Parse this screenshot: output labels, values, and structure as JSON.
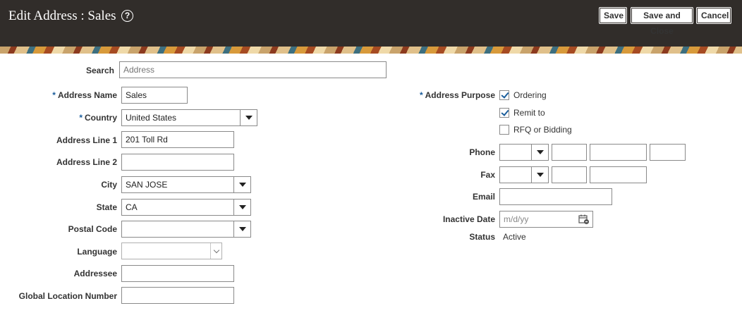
{
  "header": {
    "title": "Edit Address : Sales",
    "save_label": "Save",
    "save_close_label": "Save and Close",
    "cancel_label": "Cancel"
  },
  "search": {
    "label": "Search",
    "placeholder": "Address"
  },
  "left": {
    "address_name": {
      "label": "Address Name",
      "value": "Sales"
    },
    "country": {
      "label": "Country",
      "value": "United States"
    },
    "address_line1": {
      "label": "Address Line 1",
      "value": "201 Toll Rd"
    },
    "address_line2": {
      "label": "Address Line 2",
      "value": ""
    },
    "city": {
      "label": "City",
      "value": "SAN JOSE"
    },
    "state": {
      "label": "State",
      "value": "CA"
    },
    "postal_code": {
      "label": "Postal Code",
      "value": ""
    },
    "language": {
      "label": "Language",
      "value": ""
    },
    "addressee": {
      "label": "Addressee",
      "value": ""
    },
    "gln": {
      "label": "Global Location Number",
      "value": ""
    }
  },
  "right": {
    "address_purpose": {
      "label": "Address Purpose",
      "options": [
        {
          "label": "Ordering",
          "checked": true
        },
        {
          "label": "Remit to",
          "checked": true
        },
        {
          "label": "RFQ or Bidding",
          "checked": false
        }
      ]
    },
    "phone": {
      "label": "Phone"
    },
    "fax": {
      "label": "Fax"
    },
    "email": {
      "label": "Email",
      "value": ""
    },
    "inactive_date": {
      "label": "Inactive Date",
      "placeholder": "m/d/yy"
    },
    "status": {
      "label": "Status",
      "value": "Active"
    }
  },
  "colors": {
    "header_bg": "#312d2a",
    "required": "#1a5d9b",
    "check": "#1a5d9b"
  },
  "icons": [
    "help-icon",
    "calendar-icon",
    "dropdown-arrow-icon",
    "checkmark-icon"
  ]
}
